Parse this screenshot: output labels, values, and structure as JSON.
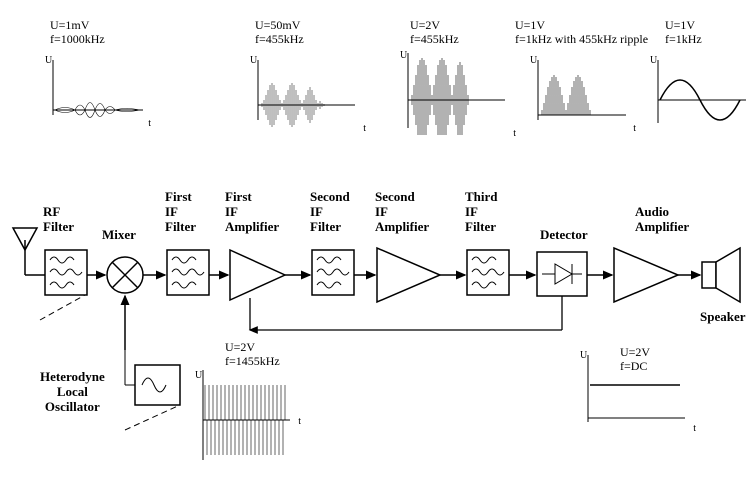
{
  "blocks": {
    "rf_filter": "RF\nFilter",
    "mixer": "Mixer",
    "hetero": "Heterodyne\nLocal\nOscillator",
    "first_if_filter": "First\nIF\nFilter",
    "first_if_amp": "First\nIF\nAmplifier",
    "second_if_filter": "Second\nIF\nFilter",
    "second_if_amp": "Second\nIF\nAmplifier",
    "third_if_filter": "Third\nIF\nFilter",
    "detector": "Detector",
    "audio_amp": "Audio\nAmplifier",
    "speaker": "Speaker"
  },
  "signals": {
    "rf": {
      "U": "U=1mV",
      "f": "f=1000kHz"
    },
    "if1": {
      "U": "U=50mV",
      "f": "f=455kHz"
    },
    "if2": {
      "U": "U=2V",
      "f": "f=455kHz"
    },
    "det": {
      "U": "U=1V",
      "f": "f=1kHz with 455kHz ripple"
    },
    "audio": {
      "U": "U=1V",
      "f": "f=1kHz"
    },
    "lo": {
      "U": "U=2V",
      "f": "f=1455kHz"
    },
    "agc": {
      "U": "U=2V",
      "f": "f=DC"
    }
  },
  "axis": {
    "y": "U",
    "x": "t"
  }
}
